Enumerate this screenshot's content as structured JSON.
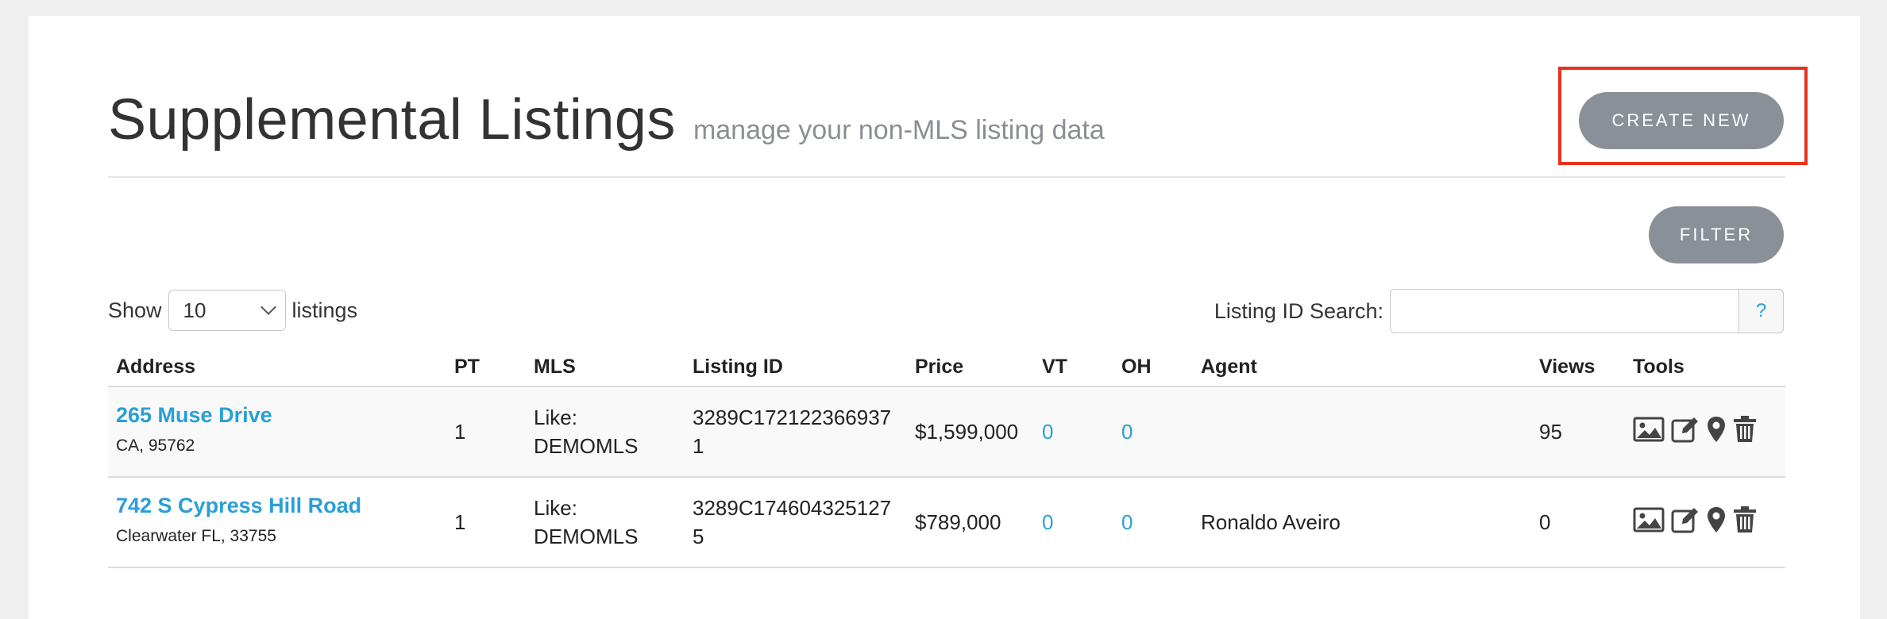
{
  "header": {
    "title": "Supplemental Listings",
    "subtitle": "manage your non-MLS listing data",
    "create_label": "CREATE NEW",
    "filter_label": "FILTER"
  },
  "controls": {
    "show_label": "Show",
    "show_value": "10",
    "listings_label": "listings",
    "search_label": "Listing ID Search:",
    "search_value": "",
    "help_label": "?"
  },
  "table": {
    "columns": [
      "Address",
      "PT",
      "MLS",
      "Listing ID",
      "Price",
      "VT",
      "OH",
      "Agent",
      "Views",
      "Tools"
    ],
    "rows": [
      {
        "address": "265 Muse Drive",
        "address_sub": "CA, 95762",
        "pt": "1",
        "mls_line1": "Like:",
        "mls_line2": "DEMOMLS",
        "id_line1": "3289C172122366937",
        "id_line2": "1",
        "price": "$1,599,000",
        "vt": "0",
        "oh": "0",
        "agent": "",
        "views": "95"
      },
      {
        "address": "742 S Cypress Hill Road",
        "address_sub": "Clearwater FL, 33755",
        "pt": "1",
        "mls_line1": "Like:",
        "mls_line2": "DEMOMLS",
        "id_line1": "3289C174604325127",
        "id_line2": "5",
        "price": "$789,000",
        "vt": "0",
        "oh": "0",
        "agent": "Ronaldo Aveiro",
        "views": "0"
      }
    ]
  },
  "tool_icons": [
    "image-icon",
    "edit-icon",
    "map-pin-icon",
    "trash-icon"
  ],
  "colors": {
    "link": "#2a9fd6",
    "button": "#8a9098",
    "highlight": "#e8321e"
  }
}
